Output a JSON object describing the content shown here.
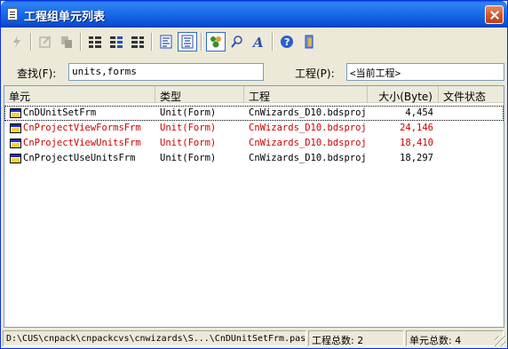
{
  "window": {
    "title": "工程组单元列表",
    "title_icon": "document-list-icon",
    "accent_color": "#0a5fd8",
    "close_icon": "close-icon"
  },
  "toolbar": {
    "buttons": [
      {
        "name": "open-unit-icon",
        "pressed": false
      },
      {
        "name": "edit-icon",
        "pressed": false
      },
      {
        "name": "copy-icon",
        "pressed": false
      },
      {
        "name": "large-icons-view-icon",
        "pressed": false
      },
      {
        "name": "small-icons-view-icon",
        "pressed": false
      },
      {
        "name": "list-view-icon",
        "pressed": false
      },
      {
        "name": "report-view-icon",
        "pressed": false
      },
      {
        "name": "details-view-icon",
        "pressed": true
      },
      {
        "name": "match-start-icon",
        "pressed": true
      },
      {
        "name": "match-any-icon",
        "pressed": false
      },
      {
        "name": "font-icon",
        "pressed": false
      },
      {
        "name": "help-icon",
        "pressed": false
      },
      {
        "name": "exit-icon",
        "pressed": false
      }
    ]
  },
  "search": {
    "label": "查找(F):",
    "value": "units,forms"
  },
  "project": {
    "label": "工程(P):",
    "value": "<当前工程>"
  },
  "list": {
    "columns": [
      "单元",
      "类型",
      "工程",
      "大小(Byte)",
      "文件状态"
    ],
    "rows": [
      {
        "unit": "CnDUnitSetFrm",
        "type": "Unit(Form)",
        "project": "CnWizards_D10.bdsproj",
        "size": "4,454",
        "status": "",
        "red": false,
        "focused": true
      },
      {
        "unit": "CnProjectViewFormsFrm",
        "type": "Unit(Form)",
        "project": "CnWizards_D10.bdsproj",
        "size": "24,146",
        "status": "",
        "red": true,
        "focused": false
      },
      {
        "unit": "CnProjectViewUnitsFrm",
        "type": "Unit(Form)",
        "project": "CnWizards_D10.bdsproj",
        "size": "18,410",
        "status": "",
        "red": true,
        "focused": false
      },
      {
        "unit": "CnProjectUseUnitsFrm",
        "type": "Unit(Form)",
        "project": "CnWizards_D10.bdsproj",
        "size": "18,297",
        "status": "",
        "red": false,
        "focused": false
      }
    ],
    "highlight_color": "#cc0000"
  },
  "statusbar": {
    "path": "D:\\CUS\\cnpack\\cnpackcvs\\cnwizards\\S...\\CnDUnitSetFrm.pas",
    "project_count": "工程总数: 2",
    "unit_count": "单元总数: 4"
  }
}
